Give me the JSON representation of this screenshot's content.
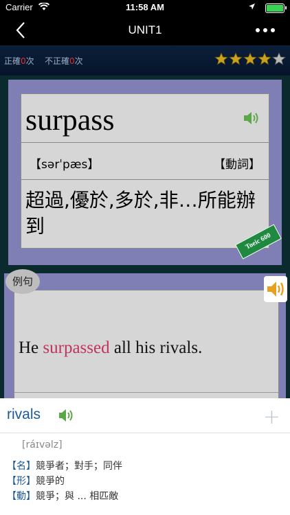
{
  "status": {
    "carrier": "Carrier",
    "time": "11:58 AM"
  },
  "nav": {
    "title": "UNIT1"
  },
  "score": {
    "correct_label": "正確",
    "correct_count": "0",
    "correct_unit": "次",
    "wrong_label": "不正確",
    "wrong_count": "0",
    "wrong_unit": "次",
    "stars": 4.5
  },
  "card": {
    "word": "surpass",
    "phonetic": "【sərˈpæs】",
    "pos": "【動詞】",
    "meaning": "超過,優於,多於,非…所能辦到",
    "tag": "Toeic 600"
  },
  "example": {
    "label": "例句",
    "before": "He ",
    "highlight": "surpassed",
    "after": " all his rivals."
  },
  "popup": {
    "word": "rivals",
    "plus": "+",
    "phonetic": "[ráɪvəlz]",
    "defs": [
      {
        "pos": "【名】",
        "text": "競爭者；對手；同伴"
      },
      {
        "pos": "【形】",
        "text": "競爭的"
      },
      {
        "pos": "【動】",
        "text": "競爭；與 ... 相匹敵"
      }
    ]
  },
  "colors": {
    "accent": "#1a5a9a",
    "highlight": "#c0345c",
    "card": "#7f7fb5"
  }
}
